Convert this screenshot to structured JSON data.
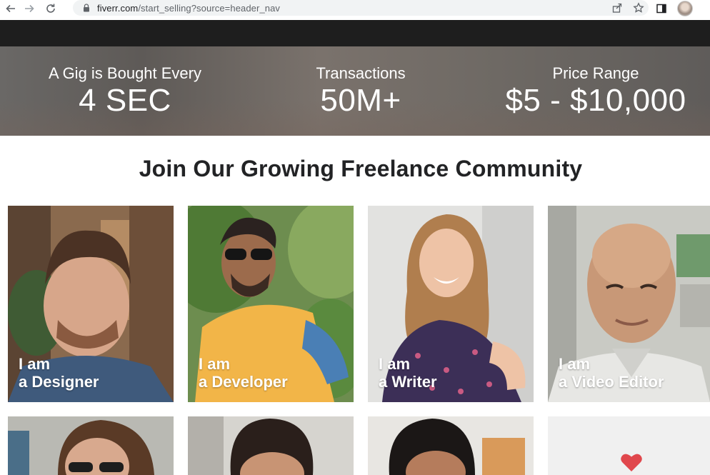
{
  "browser": {
    "url_host": "fiverr.com",
    "url_path": "/start_selling?source=header_nav",
    "icons": [
      "back-arrow-icon",
      "forward-arrow-icon",
      "reload-icon",
      "lock-icon",
      "share-icon",
      "star-icon",
      "sidepanel-icon",
      "profile-avatar"
    ]
  },
  "stats": [
    {
      "label": "A Gig is Bought Every",
      "value": "4 SEC"
    },
    {
      "label": "Transactions",
      "value": "50M+"
    },
    {
      "label": "Price Range",
      "value": "$5 - $10,000"
    }
  ],
  "community": {
    "title": "Join Our Growing Freelance Community",
    "cards": [
      {
        "line1": "I am",
        "line2": "a Designer"
      },
      {
        "line1": "I am",
        "line2": "a Developer"
      },
      {
        "line1": "I am",
        "line2": "a Writer"
      },
      {
        "line1": "I am",
        "line2": "a Video Editor"
      }
    ]
  },
  "colors": {
    "site_header": "#1e1e1e",
    "heading_text": "#222325",
    "heart": "#e0474c"
  }
}
